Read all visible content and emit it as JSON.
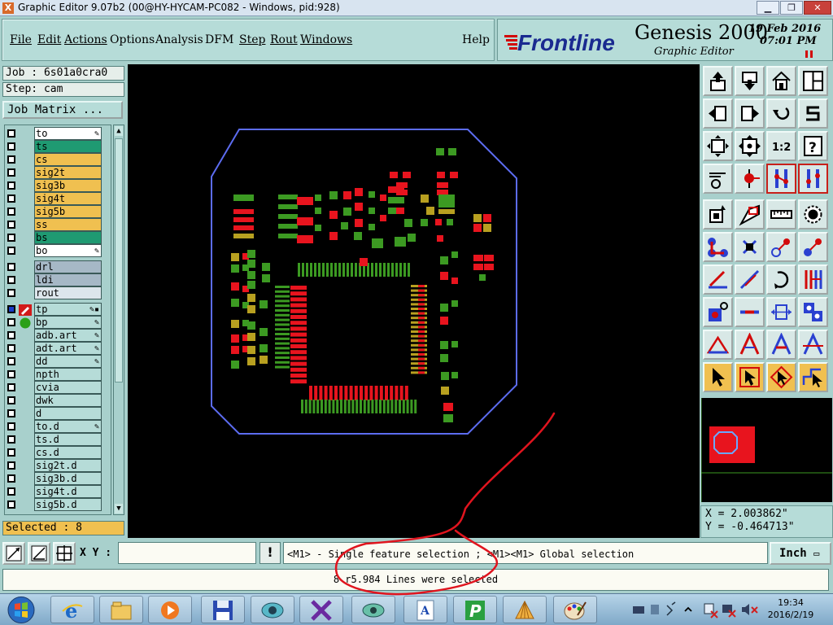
{
  "window": {
    "title": "Graphic Editor 9.07b2 (00@HY-HYCAM-PC082 - Windows, pid:928)",
    "app_icon": "X",
    "controls": [
      "minimize",
      "restore",
      "close"
    ]
  },
  "menu": {
    "items": [
      "File",
      "Edit",
      "Actions",
      "Options",
      "Analysis",
      "DFM",
      "Step",
      "Rout",
      "Windows"
    ],
    "help": "Help"
  },
  "brand": {
    "logo": "Frontline",
    "product": "Genesis 2000",
    "subtitle": "Graphic Editor",
    "date": "19 Feb 2016",
    "time": "07:01 PM"
  },
  "job": {
    "job_label": "Job : 6s01a0cra0",
    "step_label": "Step: cam",
    "matrix_button": "Job Matrix ..."
  },
  "layers": [
    {
      "name": "to",
      "color": "#ffffff",
      "mark": "✎"
    },
    {
      "name": "ts",
      "color": "#1f9a72",
      "mark": ""
    },
    {
      "name": "cs",
      "color": "#f0c050",
      "mark": ""
    },
    {
      "name": "sig2t",
      "color": "#f0c050",
      "mark": ""
    },
    {
      "name": "sig3b",
      "color": "#f0c050",
      "mark": ""
    },
    {
      "name": "sig4t",
      "color": "#f0c050",
      "mark": ""
    },
    {
      "name": "sig5b",
      "color": "#f0c050",
      "mark": ""
    },
    {
      "name": "ss",
      "color": "#f0c050",
      "mark": ""
    },
    {
      "name": "bs",
      "color": "#1f9a72",
      "mark": ""
    },
    {
      "name": "bo",
      "color": "#ffffff",
      "mark": "✎"
    },
    {
      "name": "drl",
      "color": "#a6b8c6",
      "mark": ""
    },
    {
      "name": "ldi",
      "color": "#a6b8c6",
      "mark": ""
    },
    {
      "name": "rout",
      "color": "#dde6ec",
      "mark": ""
    },
    {
      "name": "tp",
      "color": "#b6dcd8",
      "mark": "✎▪"
    },
    {
      "name": "bp",
      "color": "#b6dcd8",
      "mark": "✎"
    },
    {
      "name": "adb.art",
      "color": "#b6dcd8",
      "mark": "✎"
    },
    {
      "name": "adt.art",
      "color": "#b6dcd8",
      "mark": "✎"
    },
    {
      "name": "dd",
      "color": "#b6dcd8",
      "mark": "✎"
    },
    {
      "name": "npth",
      "color": "#b6dcd8",
      "mark": ""
    },
    {
      "name": "cvia",
      "color": "#b6dcd8",
      "mark": ""
    },
    {
      "name": "dwk",
      "color": "#b6dcd8",
      "mark": ""
    },
    {
      "name": "d",
      "color": "#b6dcd8",
      "mark": ""
    },
    {
      "name": "to.d",
      "color": "#b6dcd8",
      "mark": "✎"
    },
    {
      "name": "ts.d",
      "color": "#b6dcd8",
      "mark": ""
    },
    {
      "name": "cs.d",
      "color": "#b6dcd8",
      "mark": ""
    },
    {
      "name": "sig2t.d",
      "color": "#b6dcd8",
      "mark": ""
    },
    {
      "name": "sig3b.d",
      "color": "#b6dcd8",
      "mark": ""
    },
    {
      "name": "sig4t.d",
      "color": "#b6dcd8",
      "mark": ""
    },
    {
      "name": "sig5b.d",
      "color": "#b6dcd8",
      "mark": ""
    }
  ],
  "selected_label": "Selected : 8",
  "coords": {
    "x_label": "X = 2.003862\"",
    "y_label": "Y = -0.464713\""
  },
  "command": {
    "xy_label": "X Y :",
    "xy_value": "",
    "warn": "!",
    "hint": "<M1> - Single feature selection ; <M1><M1> Global selection",
    "unit": "Inch"
  },
  "status_message": "8 r5.984 Lines were selected",
  "taskbar": {
    "tasks": [
      "ie",
      "explorer",
      "media-player",
      "save",
      "genesis-eye",
      "x-app",
      "genesis-eye-2",
      "writer",
      "frontline-p",
      "shell",
      "paint"
    ],
    "clock_time": "19:34",
    "clock_date": "2016/2/19"
  },
  "colors": {
    "panel": "#a8d0cc",
    "layer_highlight": "#f0c050",
    "pad_red": "#e8141e",
    "pad_green": "#3c9a22",
    "pad_olive": "#b8a020",
    "outline_blue": "#5c6cf0",
    "annotation_red": "#e0141e"
  }
}
